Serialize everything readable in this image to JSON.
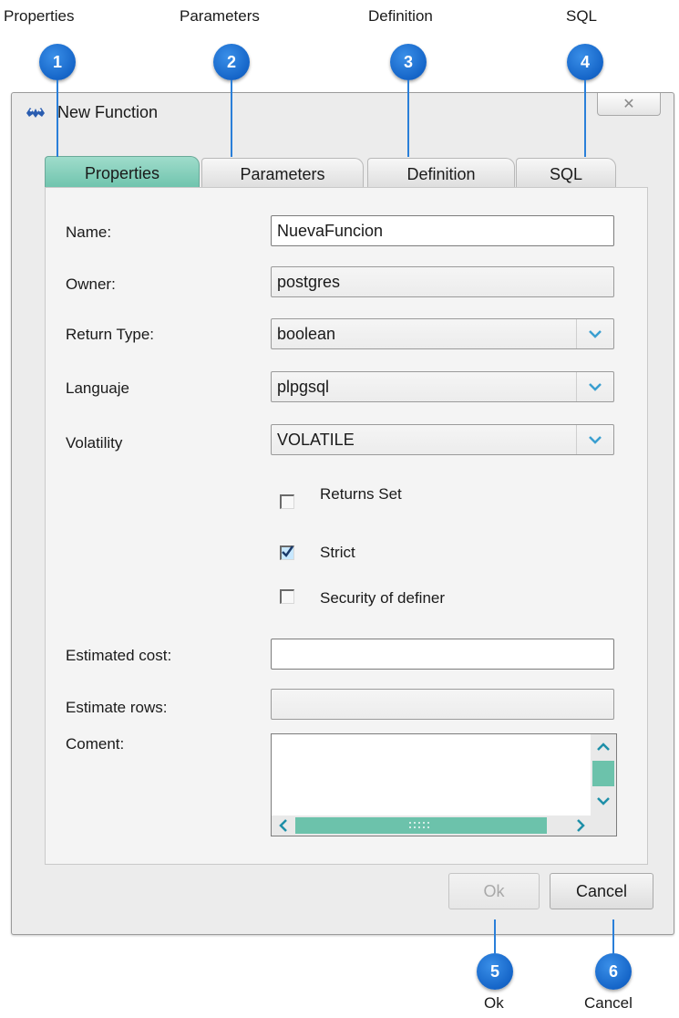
{
  "callouts": [
    {
      "number": "1",
      "label": "Properties"
    },
    {
      "number": "2",
      "label": "Parameters"
    },
    {
      "number": "3",
      "label": "Definition"
    },
    {
      "number": "4",
      "label": "SQL"
    },
    {
      "number": "5",
      "label": "Ok"
    },
    {
      "number": "6",
      "label": "Cancel"
    }
  ],
  "window": {
    "title": "New Function",
    "app_icon": "pgadmin-elephant-icon",
    "close_icon": "close-icon",
    "close_glyph": "✕"
  },
  "tabs": [
    {
      "label": "Properties",
      "active": true
    },
    {
      "label": "Parameters",
      "active": false
    },
    {
      "label": "Definition",
      "active": false
    },
    {
      "label": "SQL",
      "active": false
    }
  ],
  "form": {
    "name": {
      "label": "Name:",
      "value": "NuevaFuncion"
    },
    "owner": {
      "label": "Owner:",
      "value": "postgres"
    },
    "return_type": {
      "label": "Return Type:",
      "value": "boolean"
    },
    "language": {
      "label": "Languaje",
      "value": "plpgsql"
    },
    "volatility": {
      "label": "Volatility",
      "value": "VOLATILE"
    },
    "returns_set": {
      "label": "Returns Set",
      "checked": false
    },
    "strict": {
      "label": "Strict",
      "checked": true
    },
    "security_definer": {
      "label": "Security of definer",
      "checked": false
    },
    "estimated_cost": {
      "label": "Estimated cost:",
      "value": ""
    },
    "estimate_rows": {
      "label": "Estimate rows:",
      "value": ""
    },
    "comment": {
      "label": "Coment:",
      "value": ""
    }
  },
  "buttons": {
    "ok": "Ok",
    "cancel": "Cancel"
  },
  "colors": {
    "accent": "#6cc2ab",
    "callout": "#1565c8"
  }
}
